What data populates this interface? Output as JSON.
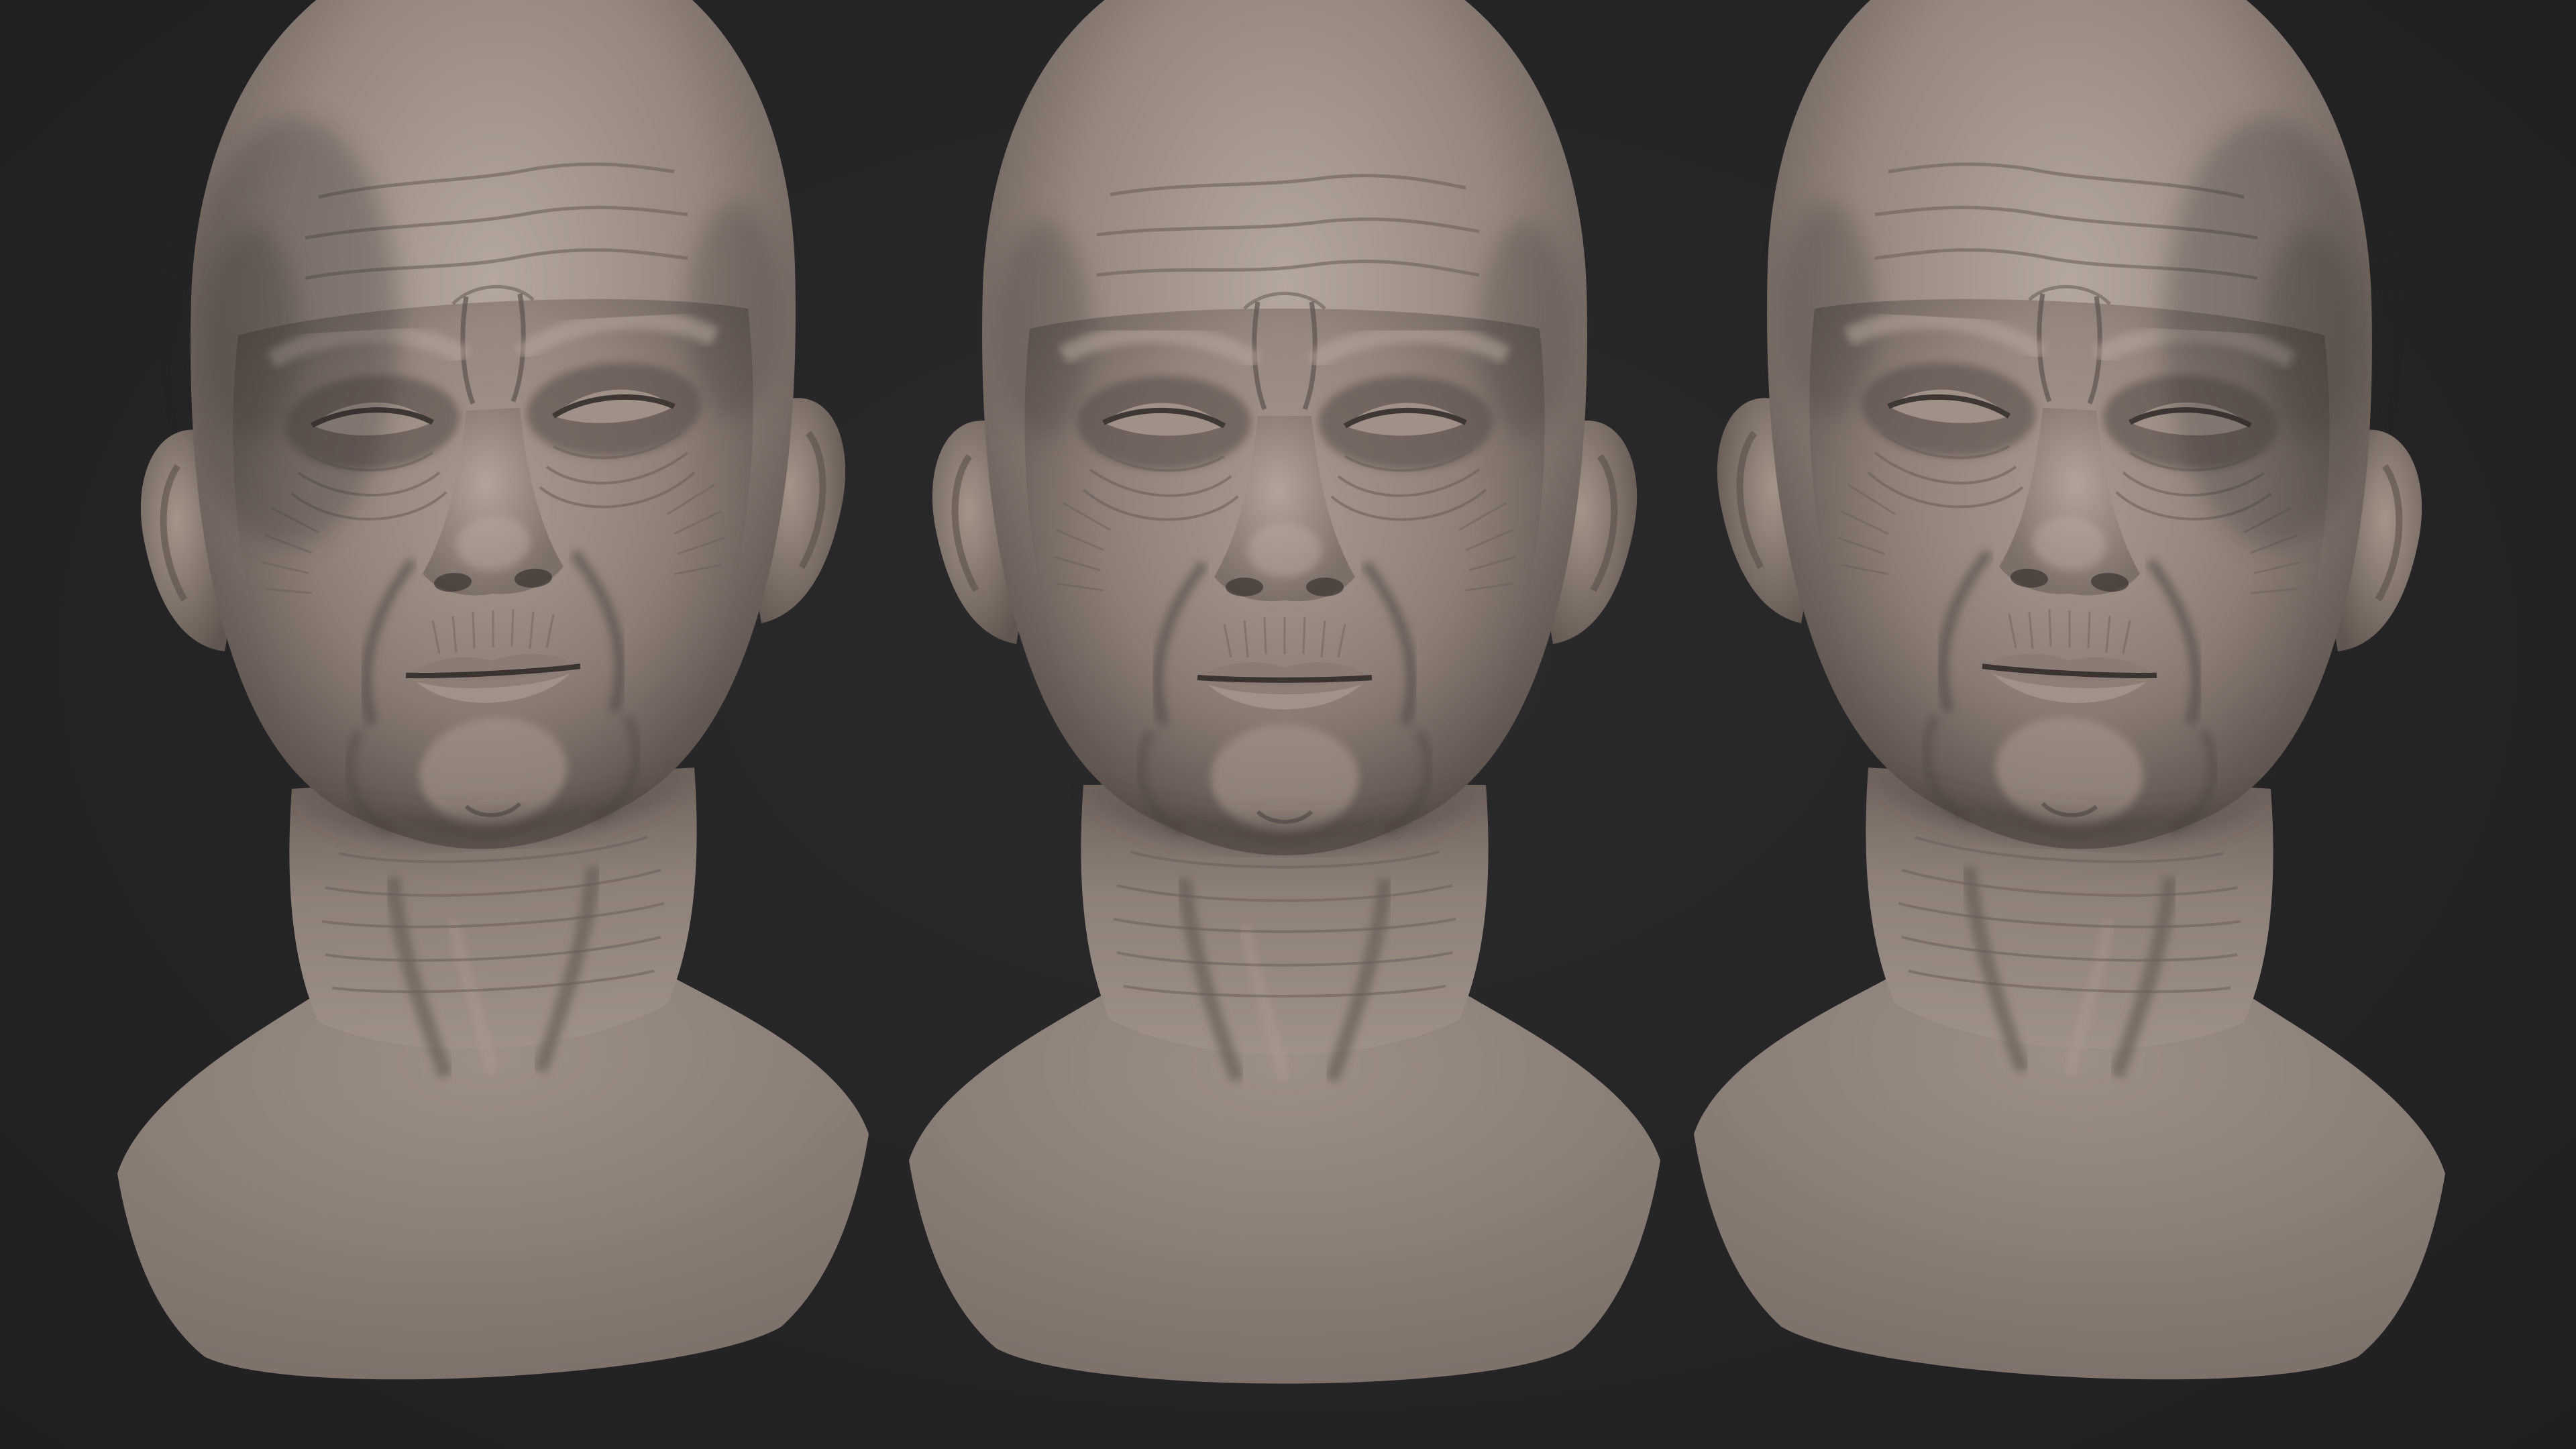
{
  "scene": {
    "background_color": "#252527",
    "clay_color": "#8f827a",
    "clay_highlight": "#b3a69c",
    "clay_shadow": "#4e4541",
    "views": [
      {
        "id": "three-quarter-left",
        "icon": "sculpt-head-icon"
      },
      {
        "id": "front",
        "icon": "sculpt-head-icon"
      },
      {
        "id": "three-quarter-right",
        "icon": "sculpt-head-icon"
      }
    ]
  }
}
